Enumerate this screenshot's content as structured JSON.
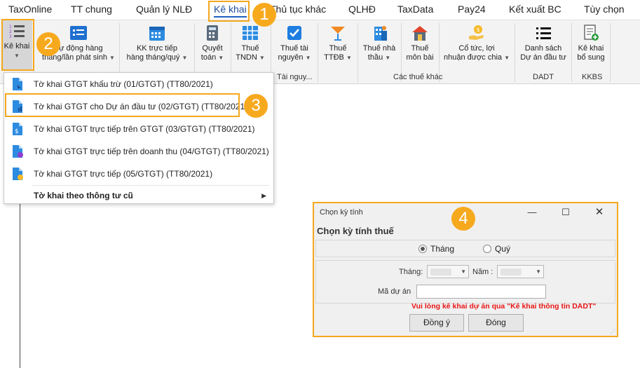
{
  "menu": {
    "tabs": [
      "TaxOnline",
      "TT chung",
      "Quản lý NLĐ",
      "Kê khai",
      "Thủ tục khác",
      "QLHĐ",
      "TaxData",
      "Pay24",
      "Kết xuất BC",
      "Tùy chọn"
    ],
    "active_tab": "Kê khai"
  },
  "ribbon": {
    "ke_khai": "Kê khai",
    "tu_dong_line1": "Tự động hàng",
    "tu_dong_line2": "tháng/lần phát sinh",
    "kk_truc_tiep_line1": "KK trực tiếp",
    "kk_truc_tiep_line2": "hàng tháng/quý",
    "quyet_toan_line1": "Quyết",
    "quyet_toan_line2": "toán",
    "thue_tndn_line1": "Thuế",
    "thue_tndn_line2": "TNDN",
    "thue_tai_nguyen_line1": "Thuế tài",
    "thue_tai_nguyen_line2": "nguyên",
    "thue_ttdb_line1": "Thuế",
    "thue_ttdb_line2": "TTĐB",
    "thue_nha_thau_line1": "Thuế nhà",
    "thue_nha_thau_line2": "thầu",
    "thue_mon_bai_line1": "Thuế",
    "thue_mon_bai_line2": "môn bài",
    "co_tuc_line1": "Cổ tức, lợi",
    "co_tuc_line2": "nhuận được chia",
    "danh_sach_line1": "Danh sách",
    "danh_sach_line2": "Dự án đầu tư",
    "ke_khai_bs_line1": "Kê khai",
    "ke_khai_bs_line2": "bổ sung",
    "group_tai_nguyen": "Tài nguy...",
    "group_cac_thue_khac": "Các thuế khác",
    "group_dadt": "DADT",
    "group_kkbs": "KKBS"
  },
  "dropdown": {
    "items": [
      "Tờ khai GTGT khấu trừ (01/GTGT) (TT80/2021)",
      "Tờ khai GTGT cho Dự án đầu tư (02/GTGT) (TT80/2021)",
      "Tờ khai GTGT trực tiếp trên GTGT (03/GTGT) (TT80/2021)",
      "Tờ khai GTGT trực tiếp trên doanh thu (04/GTGT) (TT80/2021)",
      "Tờ khai GTGT trực tiếp (05/GTGT) (TT80/2021)"
    ],
    "submenu": "Tờ khai theo thông tư cũ"
  },
  "callouts": [
    "1",
    "2",
    "3",
    "4"
  ],
  "dialog": {
    "window_title": "Chọn kỳ tính",
    "heading": "Chọn kỳ tính thuế",
    "radio_thang": "Tháng",
    "radio_quy": "Quý",
    "selected_period": "Tháng",
    "label_thang": "Tháng:",
    "label_nam": "Năm :",
    "label_ma_du_an": "Mã dự án",
    "warning": "Vui lòng kê khai dự án qua \"Kê khai thông tin DADT\"",
    "ok_button": "Đồng ý",
    "close_button": "Đóng"
  },
  "colors": {
    "accent": "#f4a81d",
    "active_tab": "#1f5fbf",
    "warning": "#e81515"
  }
}
